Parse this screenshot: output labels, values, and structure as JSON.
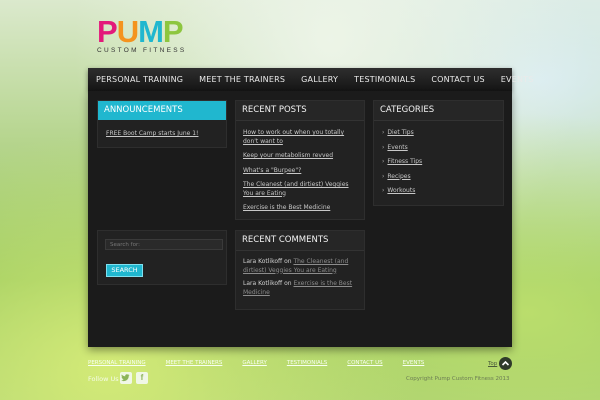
{
  "logo": {
    "letters": [
      {
        "char": "P",
        "color": "#e3197a"
      },
      {
        "char": "U",
        "color": "#f4931e"
      },
      {
        "char": "M",
        "color": "#20b7cf"
      },
      {
        "char": "P",
        "color": "#8dc63f"
      }
    ],
    "tagline": "CUSTOM FITNESS"
  },
  "nav": {
    "items": [
      "PERSONAL TRAINING",
      "MEET THE TRAINERS",
      "GALLERY",
      "TESTIMONIALS",
      "CONTACT US",
      "EVENTS"
    ]
  },
  "announcements": {
    "title": "ANNOUNCEMENTS",
    "item": "FREE Boot Camp starts June 1!"
  },
  "recent_posts": {
    "title": "RECENT POSTS",
    "items": [
      "How to work out when you totally don't want to",
      "Keep your metabolism revved",
      "What's a \"Burpee\"?",
      "The Cleanest (and dirtiest) Veggies You are Eating",
      "Exercise is the Best Medicine"
    ]
  },
  "categories": {
    "title": "CATEGORIES",
    "items": [
      "Diet Tips",
      "Events",
      "Fitness Tips",
      "Recipes",
      "Workouts"
    ]
  },
  "search": {
    "placeholder": "Search for:",
    "button": "SEARCH"
  },
  "recent_comments": {
    "title": "RECENT COMMENTS",
    "items": [
      {
        "author": "Lara Kotlikoff",
        "on": "on",
        "post": "The Cleanest (and dirtiest) Veggies You are Eating"
      },
      {
        "author": "Lara Kotlikoff",
        "on": "on",
        "post": "Exercise is the Best Medicine"
      }
    ]
  },
  "footer": {
    "links": [
      "PERSONAL TRAINING",
      "MEET THE TRAINERS",
      "GALLERY",
      "TESTIMONIALS",
      "CONTACT US",
      "EVENTS"
    ],
    "follow": "Follow Us",
    "top": "Top",
    "copyright": "Copyright Pump Custom Fitness 2013"
  },
  "colors": {
    "accent": "#20b7cf",
    "panel": "#222222"
  }
}
